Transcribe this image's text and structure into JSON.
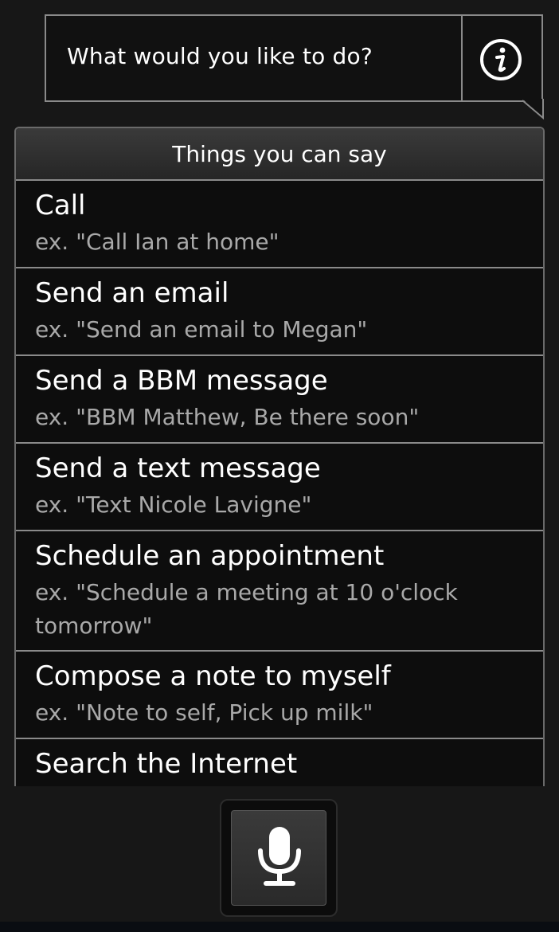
{
  "prompt": {
    "question": "What would you like to do?",
    "info_icon": "info-icon"
  },
  "suggestions": {
    "header": "Things you can say",
    "items": [
      {
        "title": "Call",
        "example": "ex. \"Call Ian at home\""
      },
      {
        "title": "Send an email",
        "example": "ex. \"Send an email to Megan\""
      },
      {
        "title": "Send a BBM message",
        "example": "ex. \"BBM Matthew, Be there soon\""
      },
      {
        "title": "Send a text message",
        "example": "ex. \"Text Nicole Lavigne\""
      },
      {
        "title": "Schedule an appointment",
        "example": "ex. \"Schedule a meeting at 10 o'clock tomorrow\""
      },
      {
        "title": "Compose a note to myself",
        "example": "ex. \"Note to self, Pick up milk\""
      },
      {
        "title": "Search the Internet",
        "example": ""
      }
    ]
  },
  "voice": {
    "mic_icon": "microphone-icon"
  },
  "colors": {
    "background": "#171717",
    "text": "#ffffff",
    "example_text": "#a9a9a9",
    "border": "#8a8a8a"
  }
}
